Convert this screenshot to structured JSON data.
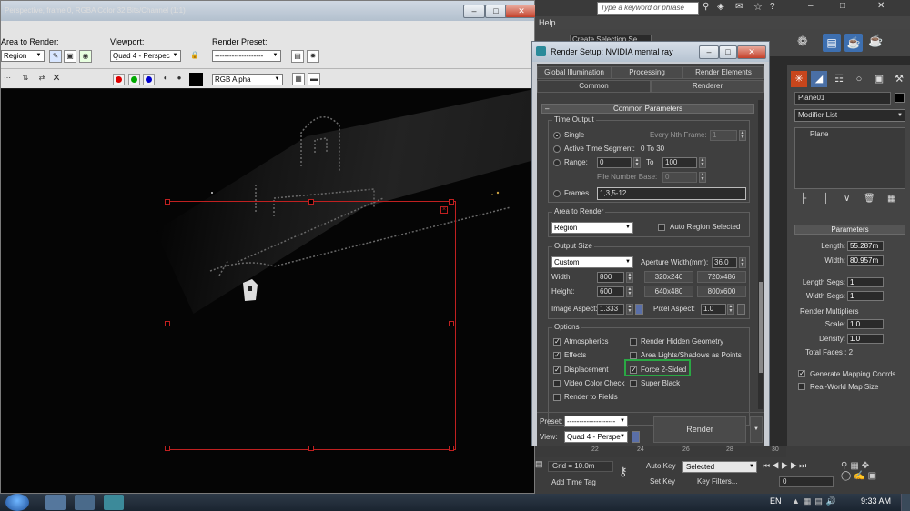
{
  "frame_window": {
    "title": "Perspective, frame 0, RGBA Color 32 Bits/Channel (1:1)",
    "area_label": "Area to Render:",
    "area_value": "Region",
    "viewport_label": "Viewport:",
    "viewport_value": "Quad 4 - Perspec",
    "preset_label": "Render Preset:",
    "preset_value": "--------------------",
    "channel_value": "RGB Alpha"
  },
  "main": {
    "search_placeholder": "Type a keyword or phrase",
    "menu_help": "Help",
    "selection_set": "Create Selection Se"
  },
  "render_setup": {
    "title": "Render Setup: NVIDIA mental ray",
    "tabs_row1": [
      "Global Illumination",
      "Processing",
      "Render Elements"
    ],
    "tabs_row2": [
      "Common",
      "Renderer"
    ],
    "rollout_title": "Common Parameters",
    "time_output": {
      "title": "Time Output",
      "single": "Single",
      "every_nth": "Every Nth Frame:",
      "every_nth_value": "1",
      "active_segment": "Active Time Segment:",
      "active_segment_value": "0 To 30",
      "range": "Range:",
      "range_from": "0",
      "range_to_label": "To",
      "range_to": "100",
      "file_number_base": "File Number Base:",
      "file_number_base_value": "0",
      "frames": "Frames",
      "frames_value": "1,3,5-12"
    },
    "area_to_render": {
      "title": "Area to Render",
      "value": "Region",
      "auto_region": "Auto Region Selected"
    },
    "output_size": {
      "title": "Output Size",
      "preset": "Custom",
      "aperture_label": "Aperture Width(mm):",
      "aperture_value": "36.0",
      "width_label": "Width:",
      "width_value": "800",
      "height_label": "Height:",
      "height_value": "600",
      "presets": [
        "320x240",
        "720x486",
        "640x480",
        "800x600"
      ],
      "image_aspect_label": "Image Aspect:",
      "image_aspect_value": "1.333",
      "pixel_aspect_label": "Pixel Aspect:",
      "pixel_aspect_value": "1.0"
    },
    "options": {
      "title": "Options",
      "atmospherics": "Atmospherics",
      "render_hidden": "Render Hidden Geometry",
      "effects": "Effects",
      "area_lights": "Area Lights/Shadows as Points",
      "displacement": "Displacement",
      "force_2sided": "Force 2-Sided",
      "video_color": "Video Color Check",
      "super_black": "Super Black",
      "render_fields": "Render to Fields"
    },
    "footer": {
      "preset_label": "Preset:",
      "preset_value": "--------------------",
      "view_label": "View:",
      "view_value": "Quad 4 - Perspe",
      "render_button": "Render"
    }
  },
  "command_panel": {
    "object_name": "Plane01",
    "modifier_list": "Modifier List",
    "stack_item": "Plane",
    "parameters_title": "Parameters",
    "length_label": "Length:",
    "length_value": "55.287m",
    "width_label": "Width:",
    "width_value": "80.957m",
    "length_segs_label": "Length Segs:",
    "length_segs_value": "1",
    "width_segs_label": "Width Segs:",
    "width_segs_value": "1",
    "render_mult_title": "Render Multipliers",
    "scale_label": "Scale:",
    "scale_value": "1.0",
    "density_label": "Density:",
    "density_value": "1.0",
    "total_faces": "Total Faces : 2",
    "gen_mapping": "Generate Mapping Coords.",
    "real_world": "Real-World Map Size"
  },
  "bottom": {
    "ticks": [
      "22",
      "24",
      "26",
      "28",
      "30"
    ],
    "grid": "Grid = 10.0m",
    "add_time_tag": "Add Time Tag",
    "auto_key": "Auto Key",
    "set_key": "Set Key",
    "selected": "Selected",
    "key_filters": "Key Filters...",
    "frame_value": "0"
  },
  "taskbar": {
    "lang": "EN",
    "time": "9:33 AM"
  }
}
